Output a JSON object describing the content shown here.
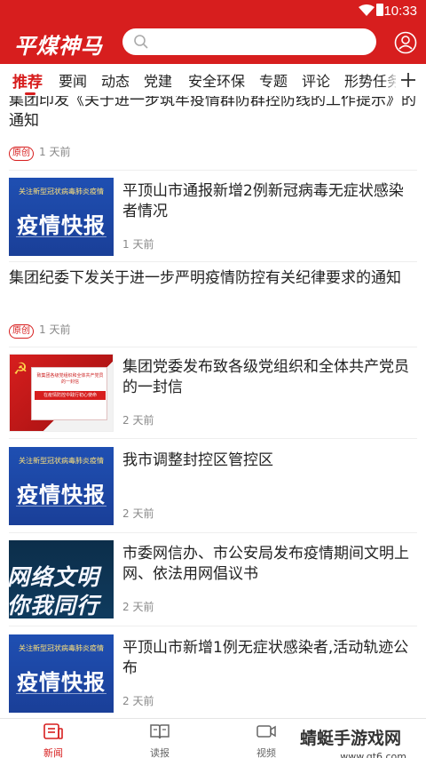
{
  "status_bar": {
    "time": "10:33"
  },
  "header": {
    "logo_text": "平煤神马",
    "search": {
      "placeholder": ""
    }
  },
  "tabs": [
    {
      "label": "推荐",
      "active": true
    },
    {
      "label": "要闻"
    },
    {
      "label": "动态"
    },
    {
      "label": "党建"
    },
    {
      "label": "安全环保"
    },
    {
      "label": "专题"
    },
    {
      "label": "评论"
    },
    {
      "label": "形势任务"
    }
  ],
  "feed": [
    {
      "title": "集团印发《关于进一步筑牢疫情群防群控防线的工作提示》的通知",
      "badge": "原创",
      "time": "1 天前"
    },
    {
      "title": "平顶山市通报新增2例新冠病毒无症状感染者情况",
      "time": "1 天前",
      "thumb": {
        "kind": "epidemic",
        "line1": "关注新型冠状病毒肺炎疫情",
        "line2": "疫情快报"
      }
    },
    {
      "title": "集团纪委下发关于进一步严明疫情防控有关纪律要求的通知",
      "badge": "原创",
      "time": "1 天前"
    },
    {
      "title": "集团党委发布致各级党组织和全体共产党员的一封信",
      "time": "2 天前",
      "thumb": {
        "kind": "party",
        "line1": "致集团各级党组织和全体共产党员的一封信",
        "line2": "在疫情防控中践行初心使命"
      }
    },
    {
      "title": "我市调整封控区管控区",
      "time": "2 天前",
      "thumb": {
        "kind": "epidemic",
        "line1": "关注新型冠状病毒肺炎疫情",
        "line2": "疫情快报"
      }
    },
    {
      "title": "市委网信办、市公安局发布疫情期间文明上网、依法用网倡议书",
      "time": "2 天前",
      "thumb": {
        "kind": "net",
        "line1": "网络文明",
        "line2": "你我同行"
      }
    },
    {
      "title": "平顶山市新增1例无症状感染者,活动轨迹公布",
      "time": "2 天前",
      "thumb": {
        "kind": "epidemic",
        "line1": "关注新型冠状病毒肺炎疫情",
        "line2": "疫情快报"
      }
    }
  ],
  "bottom_nav": [
    {
      "label": "新闻",
      "icon": "news-icon",
      "active": true
    },
    {
      "label": "读报",
      "icon": "book-icon"
    },
    {
      "label": "视频",
      "icon": "video-icon"
    }
  ],
  "watermark": {
    "text": "蜻蜓手游戏网",
    "url": "www.qt6.com"
  },
  "colors": {
    "brand": "#d71e1e"
  }
}
